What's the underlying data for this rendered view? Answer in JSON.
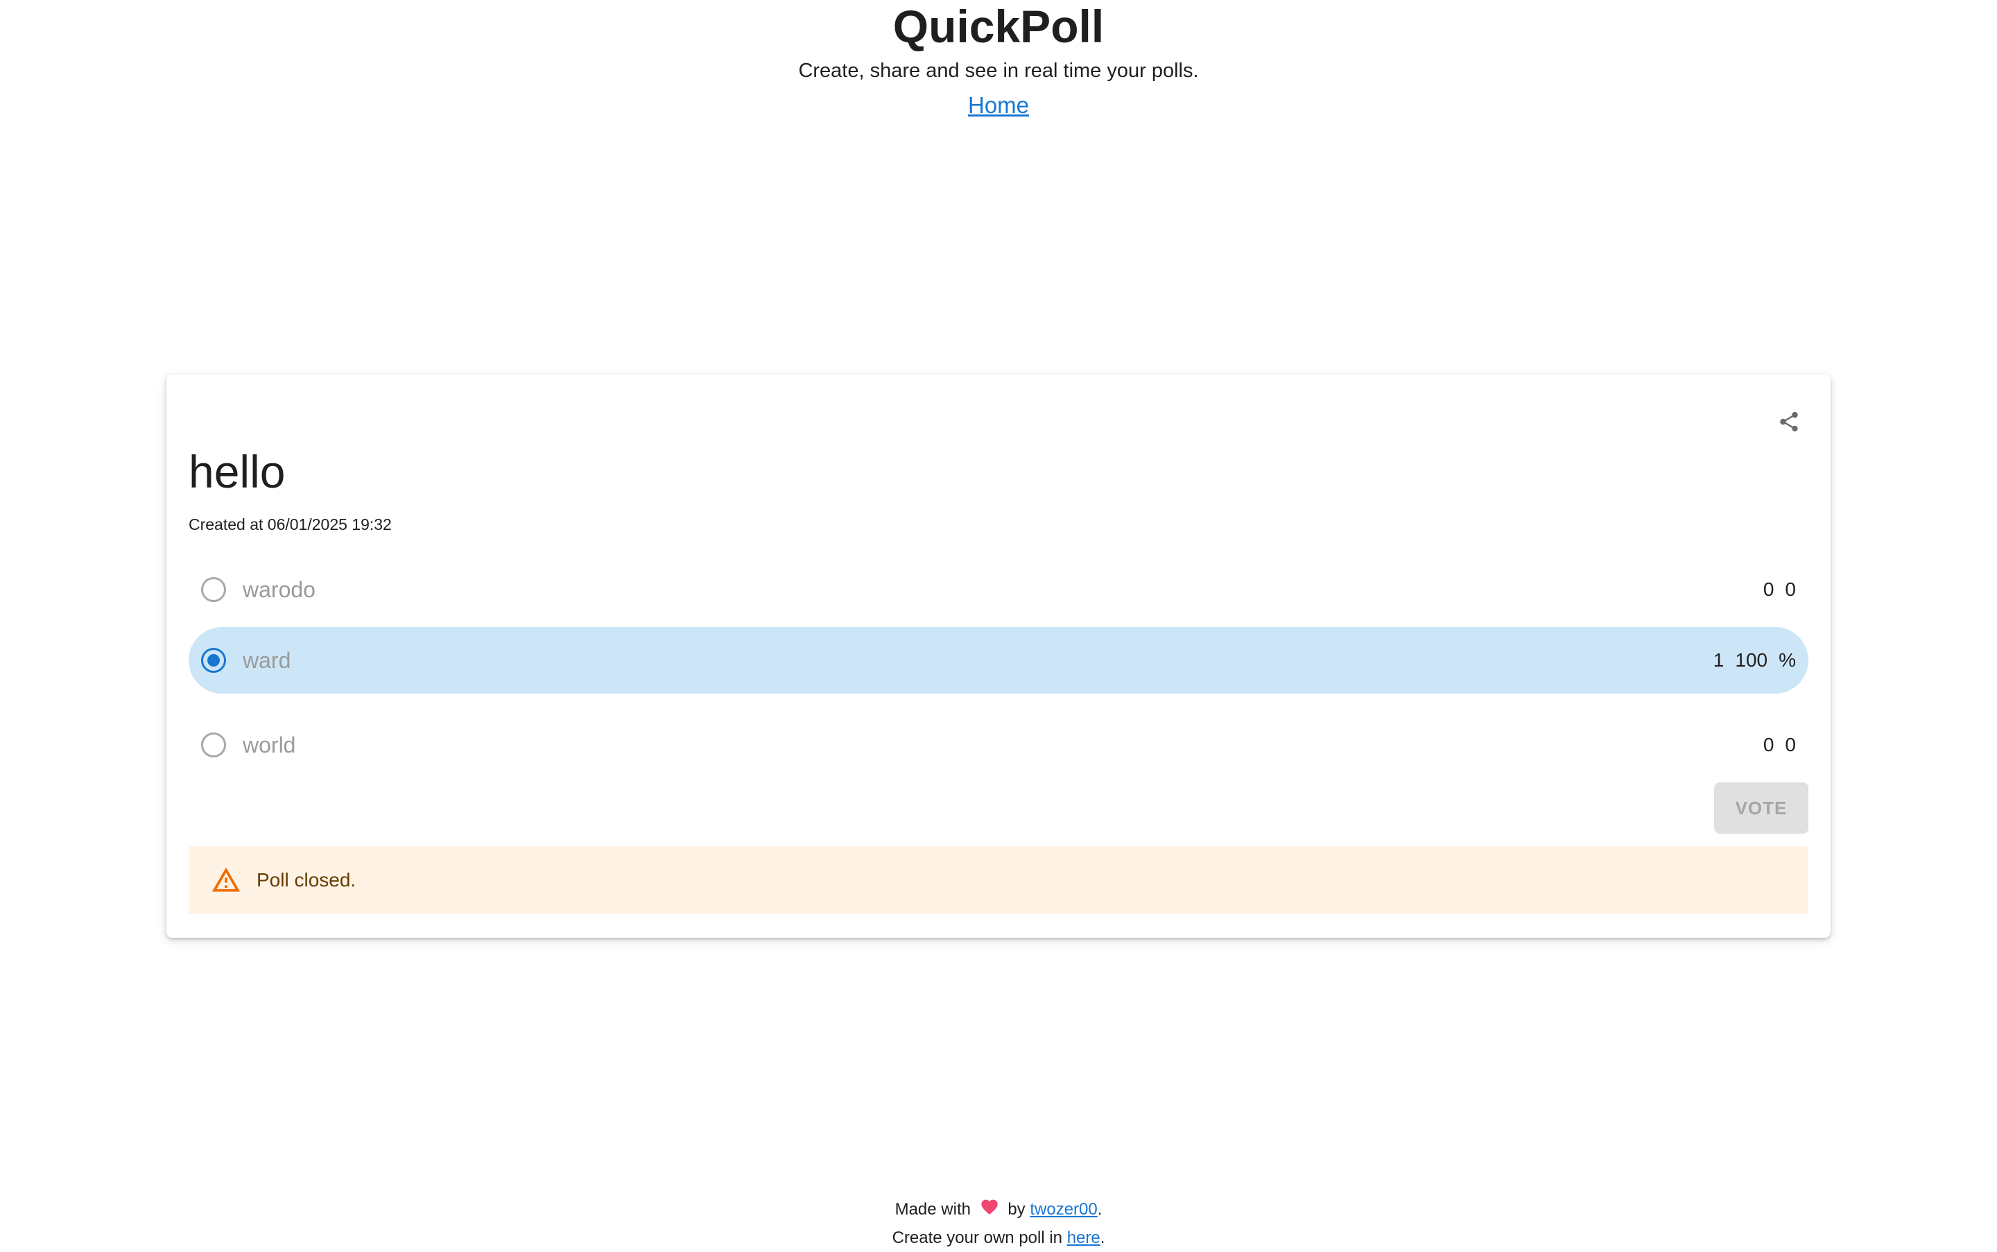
{
  "header": {
    "title": "QuickPoll",
    "tagline": "Create, share and see in real time your polls.",
    "home_link": "Home"
  },
  "poll": {
    "title": "hello",
    "created": "Created at 06/01/2025 19:32",
    "share_icon": "share-icon",
    "options": [
      {
        "label": "warodo",
        "votes": "0",
        "percent": "0",
        "suffix": "",
        "selected": false
      },
      {
        "label": "ward",
        "votes": "1",
        "percent": "100",
        "suffix": "%",
        "selected": true
      },
      {
        "label": "world",
        "votes": "0",
        "percent": "0",
        "suffix": "",
        "selected": false
      }
    ],
    "vote_label": "VOTE",
    "alert": {
      "icon": "warning-icon",
      "text": "Poll closed."
    }
  },
  "footer": {
    "made_with": "Made with",
    "heart_icon": "heart-icon",
    "by": "by",
    "author": "twozer00",
    "period1": ".",
    "create_text": "Create your own poll in",
    "here_link": "here",
    "period2": "."
  },
  "colors": {
    "accent": "#1976d2",
    "selected_bg": "#cce6f8",
    "alert_bg": "#fff3e5",
    "warning": "#ed6c02",
    "heart": "#ef476f"
  }
}
